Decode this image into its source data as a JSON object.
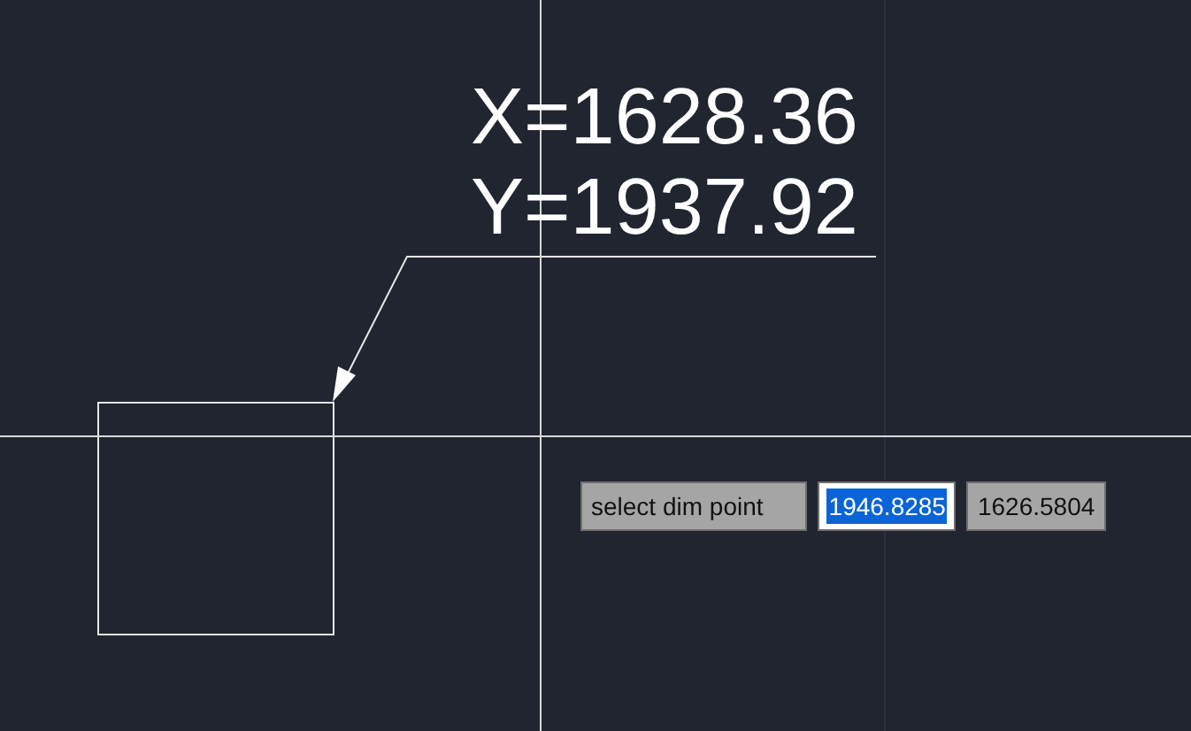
{
  "annotation": {
    "lines": [
      "X=1628.36",
      "Y=1937.92"
    ]
  },
  "dynamic_input": {
    "prompt": "select dim point",
    "fields": [
      {
        "value": "1946.8285",
        "selected": true
      },
      {
        "value": "1626.5804",
        "selected": false
      }
    ]
  }
}
